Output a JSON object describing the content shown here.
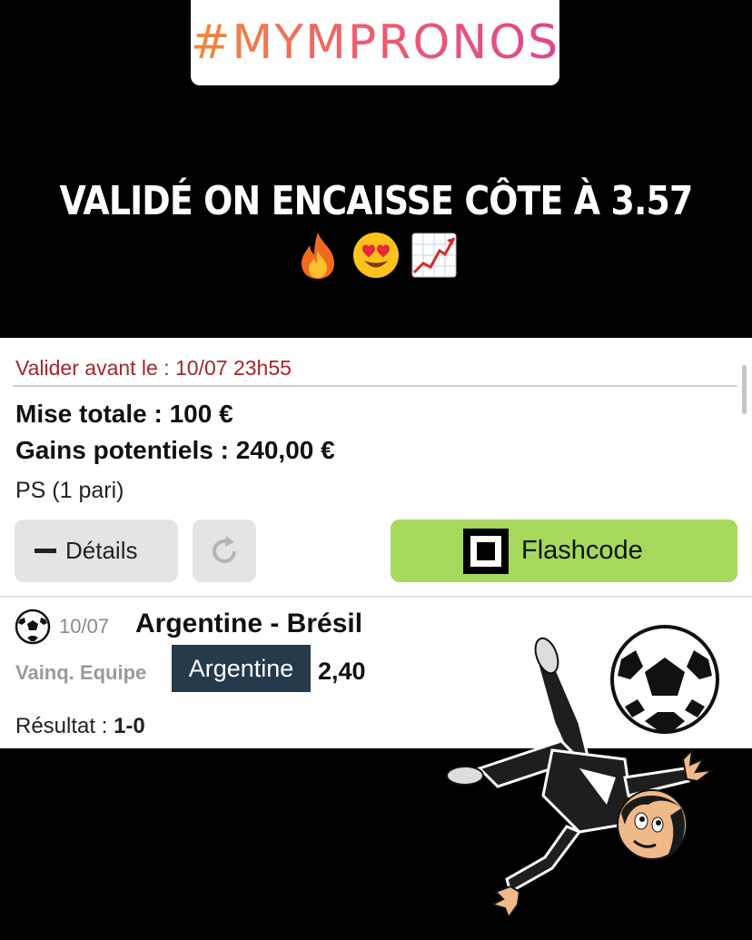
{
  "story": {
    "hashtag": "#MYMPRONOS",
    "caption": "VALIDÉ ON ENCAISSE CÔTE À 3.57",
    "emojis": [
      "fire-emoji",
      "heart-eyes-emoji",
      "chart-increasing-emoji"
    ]
  },
  "ticket": {
    "validate_before": "Valider avant le : 10/07 23h55",
    "total_stake": "Mise totale : 100 €",
    "potential_gains": "Gains potentiels : 240,00 €",
    "bet_kind": "PS (1 pari)",
    "details_label": "Détails",
    "flashcode_label": "Flashcode",
    "match": {
      "date": "10/07",
      "teams": "Argentine - Brésil",
      "bet_type": "Vainq. Equipe",
      "selection": "Argentine",
      "odd": "2,40",
      "result_label": "Résultat :",
      "result_value": "1-0"
    }
  },
  "colors": {
    "flashcode_button": "#a6d85b",
    "selection_bg": "#253a4b",
    "validate_text": "#a5262a",
    "hashtag_gradient": [
      "#f08a3a",
      "#e0448f"
    ]
  }
}
